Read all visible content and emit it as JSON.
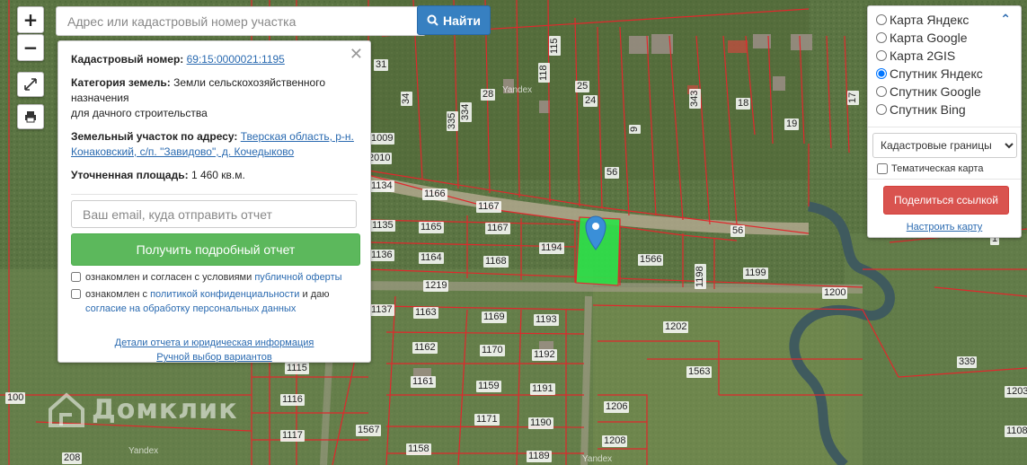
{
  "search": {
    "placeholder": "Адрес или кадастровый номер участка",
    "button_label": "Найти"
  },
  "zoom": {
    "in_label": "+",
    "out_label": "−"
  },
  "info": {
    "cadastral_label": "Кадастровый номер:",
    "cadastral_value": "69:15:0000021:1195",
    "category_label": "Категория земель:",
    "category_value": "Земли сельскохозяйственного назначения",
    "category_value_2": "для дачного строительства",
    "address_label": "Земельный участок по адресу:",
    "address_value": "Тверская область, р-н. Конаковский, с/п. \"Завидово\", д. Кочедыково",
    "area_label": "Уточненная площадь:",
    "area_value": "1 460 кв.м.",
    "email_placeholder": "Ваш email, куда отправить отчет",
    "report_button": "Получить подробный отчет",
    "agree1_prefix": "ознакомлен и согласен с условиями",
    "agree1_link": "публичной оферты",
    "agree2_prefix": "ознакомлен с",
    "agree2_link": "политикой конфиденциальности",
    "agree2_mid": "и даю",
    "agree2_link2": "согласие на обработку персональных данных",
    "details_link": "Детали отчета и юридическая информация",
    "manual_link": "Ручной выбор вариантов"
  },
  "layers": {
    "options": [
      "Карта Яндекс",
      "Карта Google",
      "Карта 2GIS",
      "Спутник Яндекс",
      "Спутник Google",
      "Спутник Bing"
    ],
    "selected": "Спутник Яндекс",
    "overlay_value": "Кадастровые границы",
    "thematic_label": "Тематическая карта",
    "share_button": "Поделиться ссылкой",
    "configure_link": "Настроить карту"
  },
  "parcels": [
    "31",
    "34",
    "334",
    "335",
    "28",
    "118",
    "115",
    "25",
    "24",
    "9",
    "343",
    "18",
    "17",
    "19",
    "56",
    "56",
    "1009",
    "2010",
    "1134",
    "1166",
    "1167",
    "1135",
    "1165",
    "1167",
    "1194",
    "1566",
    "1198",
    "1199",
    "1136",
    "1164",
    "1168",
    "1219",
    "1200",
    "1137",
    "1163",
    "1169",
    "1193",
    "1202",
    "1162",
    "1170",
    "1192",
    "1563",
    "339",
    "1115",
    "1161",
    "1159",
    "1191",
    "1116",
    "1206",
    "1171",
    "1190",
    "1117",
    "1567",
    "1158",
    "1208",
    "1189",
    "1203",
    "1108",
    "100",
    "208",
    "1"
  ],
  "colors": {
    "parcel_line": "#e0282c",
    "highlight": "#2fe04a",
    "marker": "#3a8fd8"
  },
  "brand": "Домклик",
  "watermark": "Yandex"
}
